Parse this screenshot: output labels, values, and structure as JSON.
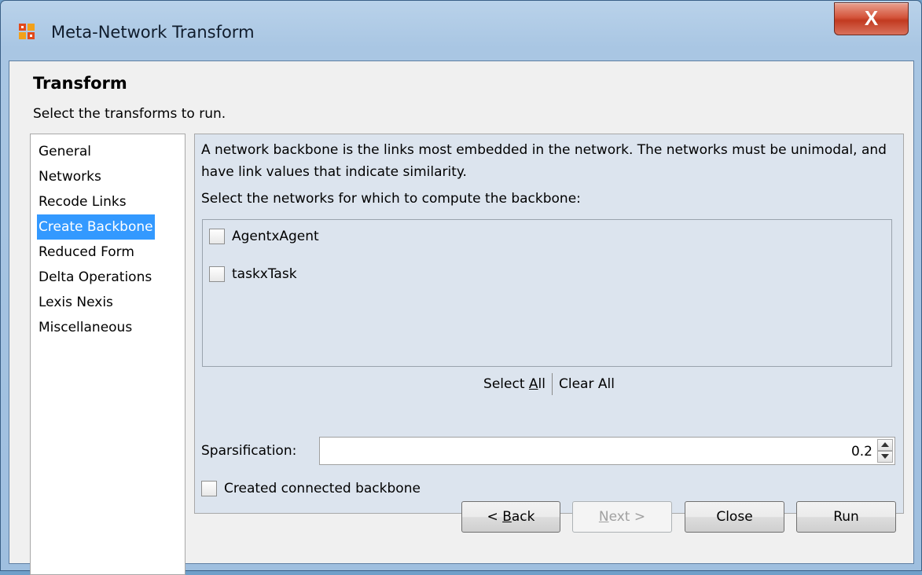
{
  "window": {
    "title": "Meta-Network Transform",
    "close_glyph": "X"
  },
  "header": {
    "title": "Transform",
    "subtitle": "Select the transforms to run."
  },
  "nav": {
    "items": [
      {
        "label": "General"
      },
      {
        "label": "Networks"
      },
      {
        "label": "Recode Links"
      },
      {
        "label": "Create Backbone"
      },
      {
        "label": "Reduced Form"
      },
      {
        "label": "Delta Operations"
      },
      {
        "label": "Lexis Nexis"
      },
      {
        "label": "Miscellaneous"
      }
    ],
    "selected": "Create Backbone"
  },
  "panel": {
    "description": "A network backbone is the links most embedded in the network. The networks must be unimodal, and have link values that indicate similarity.",
    "select_label": "Select the networks for which to compute the backbone:",
    "networks": [
      {
        "label": "AgentxAgent",
        "checked": false
      },
      {
        "label": "taskxTask",
        "checked": false
      }
    ],
    "select_all_prefix": "Select ",
    "select_all_mnemonic": "A",
    "select_all_suffix": "ll",
    "clear_all": "Clear All",
    "sparsification_label": "Sparsification:",
    "sparsification_value": "0.2",
    "connected_label": "Created connected backbone",
    "connected_checked": false
  },
  "buttons": {
    "back_prefix": "< ",
    "back_mnemonic": "B",
    "back_suffix": "ack",
    "next_mnemonic": "N",
    "next_suffix": "ext >",
    "close": "Close",
    "run": "Run"
  },
  "colors": {
    "selection": "#3399ff",
    "panel_bg": "#dce4ee",
    "close_button": "#c23a20"
  }
}
